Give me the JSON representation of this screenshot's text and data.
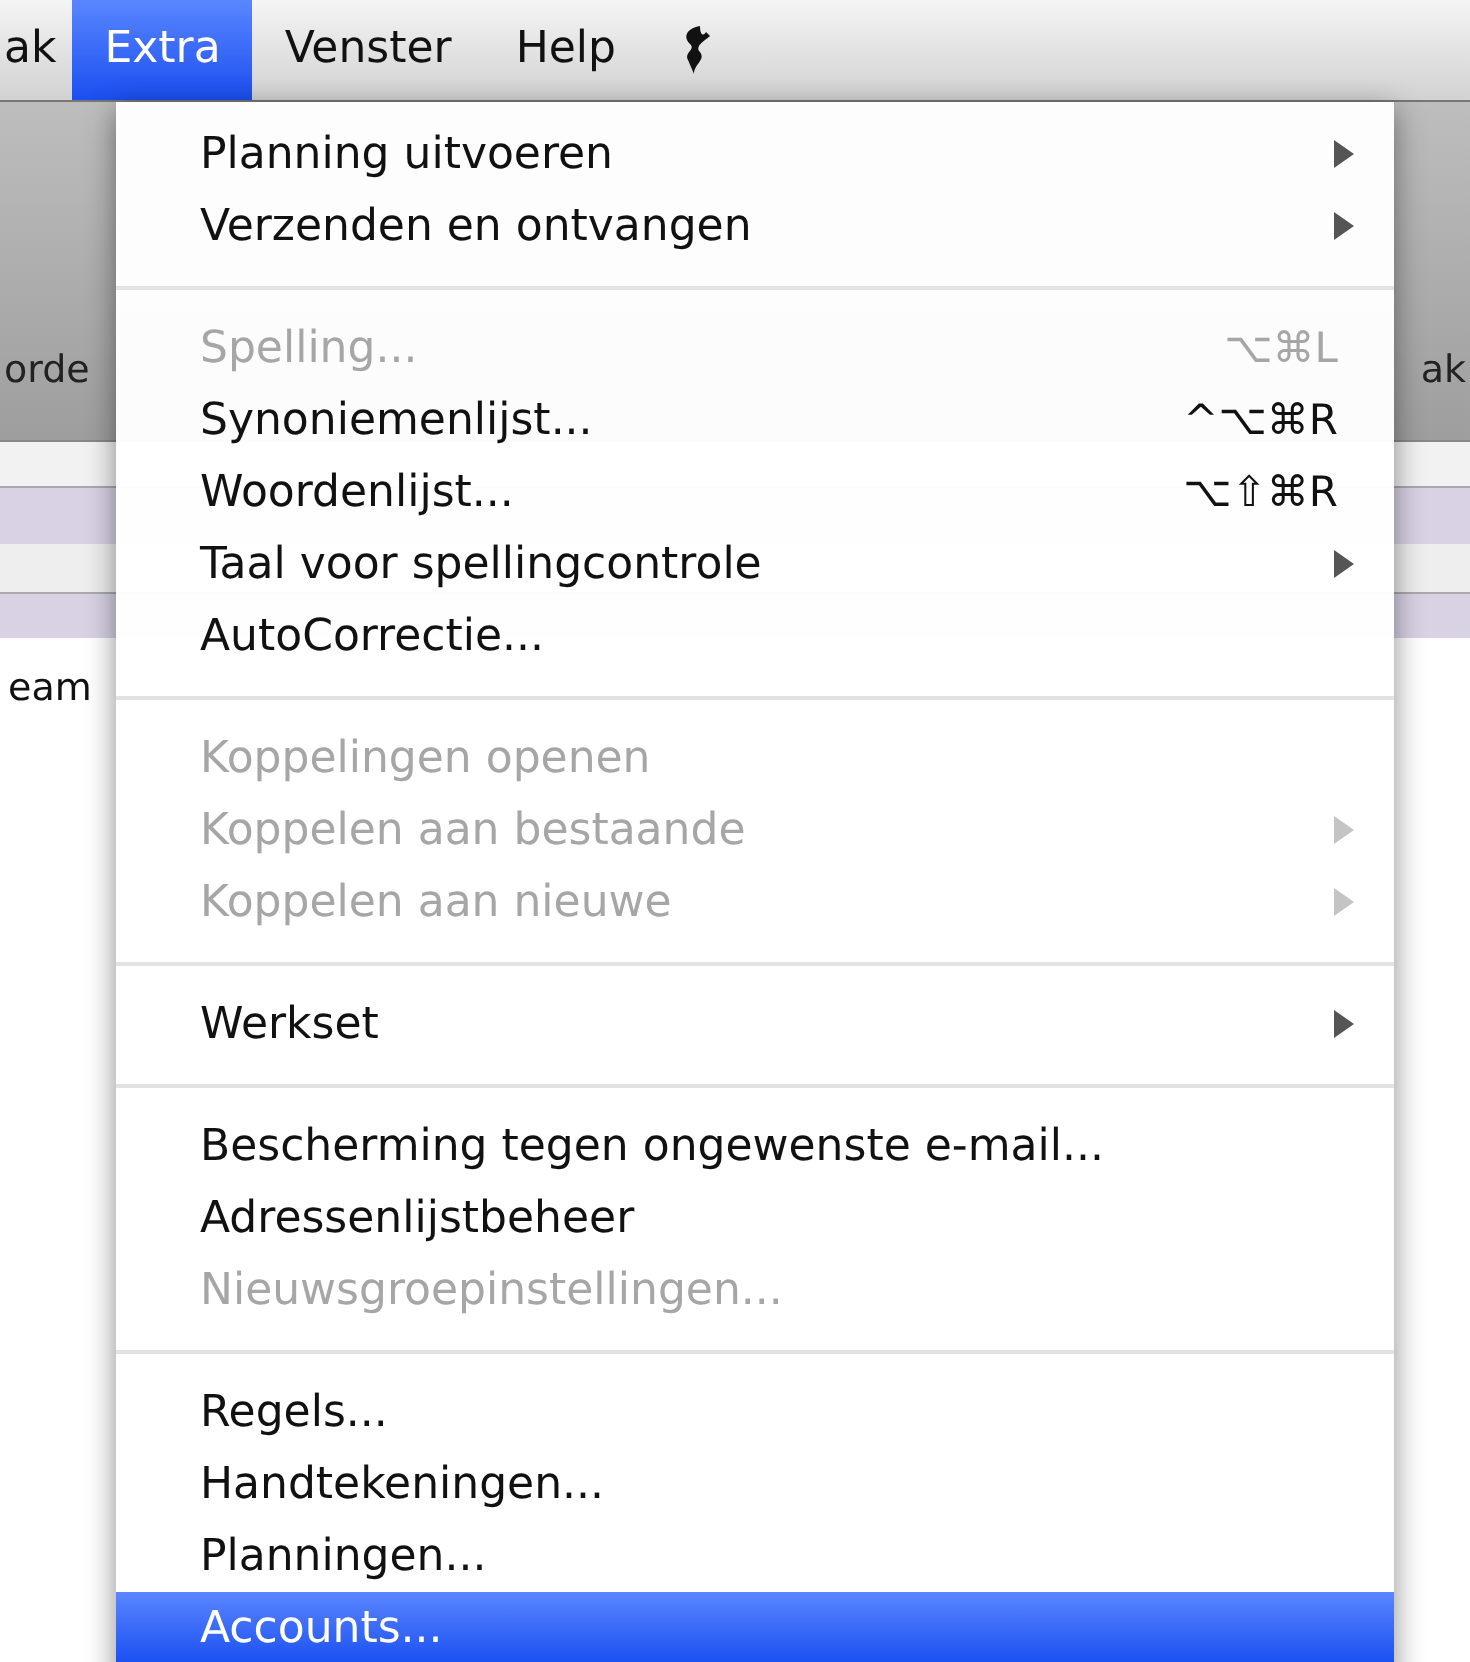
{
  "menubar": {
    "items": [
      {
        "label": "ak",
        "selected": false
      },
      {
        "label": "Extra",
        "selected": true
      },
      {
        "label": "Venster",
        "selected": false
      },
      {
        "label": "Help",
        "selected": false
      }
    ]
  },
  "background": {
    "toolbar_left_label": "orde",
    "toolbar_right_label": "ak",
    "list_text": "eam"
  },
  "menu": {
    "groups": [
      [
        {
          "label": "Planning uitvoeren",
          "disabled": false,
          "submenu": true,
          "selected": false
        },
        {
          "label": "Verzenden en ontvangen",
          "disabled": false,
          "submenu": true,
          "selected": false
        }
      ],
      [
        {
          "label": "Spelling...",
          "disabled": true,
          "submenu": false,
          "shortcut": "⌥⌘L",
          "selected": false
        },
        {
          "label": "Synoniemenlijst...",
          "disabled": false,
          "submenu": false,
          "shortcut": "^⌥⌘R",
          "selected": false
        },
        {
          "label": "Woordenlijst...",
          "disabled": false,
          "submenu": false,
          "shortcut": "⌥⇧⌘R",
          "selected": false
        },
        {
          "label": "Taal voor spellingcontrole",
          "disabled": false,
          "submenu": true,
          "selected": false
        },
        {
          "label": "AutoCorrectie...",
          "disabled": false,
          "submenu": false,
          "selected": false
        }
      ],
      [
        {
          "label": "Koppelingen openen",
          "disabled": true,
          "submenu": false,
          "selected": false
        },
        {
          "label": "Koppelen aan bestaande",
          "disabled": true,
          "submenu": true,
          "selected": false
        },
        {
          "label": "Koppelen aan nieuwe",
          "disabled": true,
          "submenu": true,
          "selected": false
        }
      ],
      [
        {
          "label": "Werkset",
          "disabled": false,
          "submenu": true,
          "selected": false
        }
      ],
      [
        {
          "label": "Bescherming tegen ongewenste e-mail...",
          "disabled": false,
          "submenu": false,
          "selected": false
        },
        {
          "label": "Adressenlijstbeheer",
          "disabled": false,
          "submenu": false,
          "selected": false
        },
        {
          "label": "Nieuwsgroepinstellingen...",
          "disabled": true,
          "submenu": false,
          "selected": false
        }
      ],
      [
        {
          "label": "Regels...",
          "disabled": false,
          "submenu": false,
          "selected": false
        },
        {
          "label": "Handtekeningen...",
          "disabled": false,
          "submenu": false,
          "selected": false
        },
        {
          "label": "Planningen...",
          "disabled": false,
          "submenu": false,
          "selected": false
        },
        {
          "label": "Accounts...",
          "disabled": false,
          "submenu": false,
          "selected": true
        }
      ]
    ]
  }
}
